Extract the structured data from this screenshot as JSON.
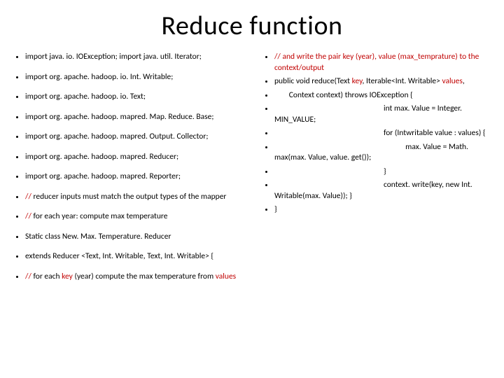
{
  "title": "Reduce function",
  "left": [
    [
      {
        "t": "import java. io. IOException; import java. util. Iterator;"
      }
    ],
    [
      {
        "t": "import org. apache. hadoop. io. Int. Writable;"
      }
    ],
    [
      {
        "t": "import org. apache. hadoop. io. Text;"
      }
    ],
    [
      {
        "t": "import org. apache. hadoop. mapred. Map. Reduce. Base;"
      }
    ],
    [
      {
        "t": "import org. apache. hadoop. mapred. Output. Collector;"
      }
    ],
    [
      {
        "t": "import org. apache. hadoop. mapred. Reducer;"
      }
    ],
    [
      {
        "t": "import org. apache. hadoop. mapred. Reporter;"
      }
    ],
    [
      {
        "t": "// ",
        "c": "red"
      },
      {
        "t": "reducer inputs must match the output types of the mapper"
      }
    ],
    [
      {
        "t": "// ",
        "c": "red"
      },
      {
        "t": "for each year: compute max temperature"
      }
    ],
    [
      {
        "t": "Static class New. Max. Temperature. Reducer"
      }
    ],
    [
      {
        "t": "extends Reducer <Text, Int. Writable, Text, Int. Writable> {"
      }
    ],
    [
      {
        "t": "// ",
        "c": "red"
      },
      {
        "t": "for each "
      },
      {
        "t": "key",
        "c": "red"
      },
      {
        "t": " (year) compute the max temperature from "
      },
      {
        "t": "values",
        "c": "red"
      }
    ]
  ],
  "right": [
    [
      {
        "t": "// ",
        "c": "red"
      },
      {
        "t": "and write the pair key (year), value (max_temprature) to the context/output",
        "c": "red"
      }
    ],
    [
      {
        "t": "public void reduce(Text "
      },
      {
        "t": "key",
        "c": "red"
      },
      {
        "t": ", Iterable<Int. Writable> "
      },
      {
        "t": "values",
        "c": "red"
      },
      {
        "t": ","
      }
    ],
    [
      {
        "t": "        Context context) throws IOException {"
      }
    ],
    [
      {
        "t": "                                                            int max. Value = Integer. MIN_VALUE;"
      }
    ],
    [
      {
        "t": "                                                            for (Intwritable value : values) {"
      }
    ],
    [
      {
        "t": "                                                                        max. Value = Math. max(max. Value, value. get());"
      }
    ],
    [
      {
        "t": "                                                            }"
      }
    ],
    [
      {
        "t": "                                                            context. write(key, new Int. Writable(max. Value)); }"
      }
    ],
    [
      {
        "t": "}"
      }
    ]
  ]
}
